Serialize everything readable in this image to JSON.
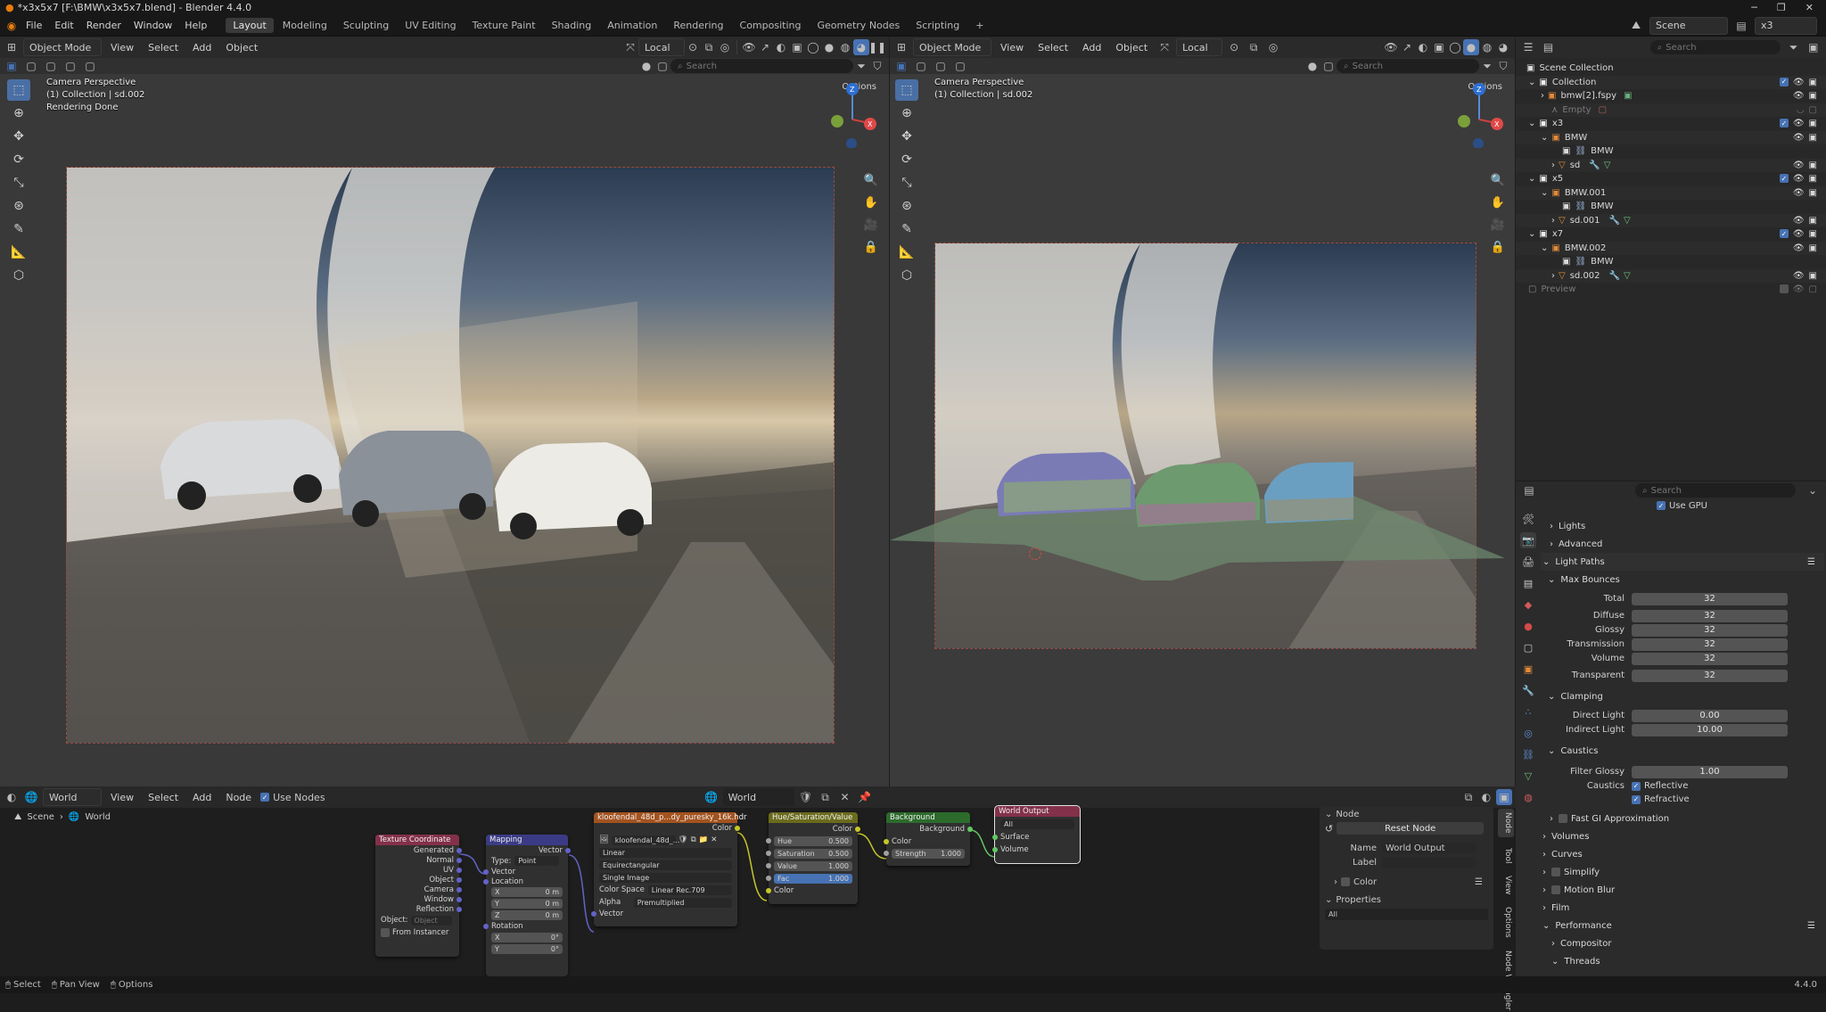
{
  "titlebar": {
    "title": "*x3x5x7 [F:\\BMW\\x3x5x7.blend] - Blender 4.4.0"
  },
  "menu": [
    "File",
    "Edit",
    "Render",
    "Window",
    "Help"
  ],
  "workspaces": [
    "Layout",
    "Modeling",
    "Sculpting",
    "UV Editing",
    "Texture Paint",
    "Shading",
    "Animation",
    "Rendering",
    "Compositing",
    "Geometry Nodes",
    "Scripting"
  ],
  "topright": {
    "scene": "Scene",
    "view_layer": "x3"
  },
  "vp_common": {
    "mode": "Object Mode",
    "menu": [
      "View",
      "Select",
      "Add",
      "Object"
    ],
    "orientation": "Local",
    "options": "Options",
    "search_placeholder": "Search"
  },
  "vp_left": {
    "info": [
      "Camera Perspective",
      "(1) Collection | sd.002",
      "Rendering Done"
    ]
  },
  "vp_right": {
    "info": [
      "Camera Perspective",
      "(1) Collection | sd.002"
    ]
  },
  "outliner": {
    "search_placeholder": "Search",
    "rows": [
      {
        "name": "Scene Collection"
      },
      {
        "name": "Collection"
      },
      {
        "name": "bmw[2].fspy"
      },
      {
        "name": "Empty"
      },
      {
        "name": "x3"
      },
      {
        "name": "BMW"
      },
      {
        "name": "BMW"
      },
      {
        "name": "sd"
      },
      {
        "name": "x5"
      },
      {
        "name": "BMW.001"
      },
      {
        "name": "BMW"
      },
      {
        "name": "sd.001"
      },
      {
        "name": "x7"
      },
      {
        "name": "BMW.002"
      },
      {
        "name": "BMW"
      },
      {
        "name": "sd.002"
      },
      {
        "name": "Preview"
      }
    ]
  },
  "properties": {
    "search_placeholder": "Search",
    "use_gpu": "Use GPU",
    "lights": "Lights",
    "advanced": "Advanced",
    "light_paths": "Light Paths",
    "max_bounces": "Max Bounces",
    "bounces": [
      {
        "label": "Total",
        "value": "32"
      },
      {
        "label": "Diffuse",
        "value": "32"
      },
      {
        "label": "Glossy",
        "value": "32"
      },
      {
        "label": "Transmission",
        "value": "32"
      },
      {
        "label": "Volume",
        "value": "32"
      },
      {
        "label": "Transparent",
        "value": "32"
      }
    ],
    "clamping": "Clamping",
    "clamp": [
      {
        "label": "Direct Light",
        "value": "0.00"
      },
      {
        "label": "Indirect Light",
        "value": "10.00"
      }
    ],
    "caustics": "Caustics",
    "filter_glossy_label": "Filter Glossy",
    "filter_glossy_value": "1.00",
    "caustics_label": "Caustics",
    "reflective": "Reflective",
    "refractive": "Refractive",
    "fast_gi": "Fast GI Approximation",
    "volumes": "Volumes",
    "curves": "Curves",
    "simplify": "Simplify",
    "motion_blur": "Motion Blur",
    "film": "Film",
    "performance": "Performance",
    "compositor": "Compositor",
    "threads": "Threads"
  },
  "node_editor": {
    "type": "World",
    "menu": [
      "View",
      "Select",
      "Add",
      "Node"
    ],
    "use_nodes": "Use Nodes",
    "world_name": "World",
    "breadcrumb": [
      "Scene",
      "World"
    ],
    "tex_coord": {
      "title": "Texture Coordinate",
      "outputs": [
        "Generated",
        "Normal",
        "UV",
        "Object",
        "Camera",
        "Window",
        "Reflection"
      ],
      "object_label": "Object:",
      "object_placeholder": "Object",
      "from_instancer": "From Instancer"
    },
    "mapping": {
      "title": "Mapping",
      "output": "Vector",
      "type_label": "Type:",
      "type_value": "Point",
      "vector": "Vector",
      "location": "Location",
      "loc": [
        {
          "axis": "X",
          "value": "0 m"
        },
        {
          "axis": "Y",
          "value": "0 m"
        },
        {
          "axis": "Z",
          "value": "0 m"
        }
      ],
      "rotation": "Rotation",
      "rot": [
        {
          "axis": "X",
          "value": "0°"
        },
        {
          "axis": "Y",
          "value": "0°"
        }
      ]
    },
    "env_tex": {
      "title": "kloofendal_48d_p...dy_puresky_16k.hdr",
      "color_out": "Color",
      "image": "kloofendal_48d_...",
      "interp": "Linear",
      "proj": "Equirectangular",
      "source": "Single Image",
      "cs_label": "Color Space",
      "cs_value": "Linear Rec.709",
      "alpha_label": "Alpha",
      "alpha_value": "Premultiplied",
      "vector": "Vector"
    },
    "hsv": {
      "title": "Hue/Saturation/Value",
      "color_out": "Color",
      "fields": [
        {
          "label": "Hue",
          "value": "0.500"
        },
        {
          "label": "Saturation",
          "value": "0.500"
        },
        {
          "label": "Value",
          "value": "1.000"
        },
        {
          "label": "Fac",
          "value": "1.000"
        }
      ],
      "color_in": "Color"
    },
    "background": {
      "title": "Background",
      "out": "Background",
      "color": "Color",
      "strength_label": "Strength",
      "strength_value": "1.000"
    },
    "world_output": {
      "title": "World Output",
      "target": "All",
      "surface": "Surface",
      "volume": "Volume"
    },
    "panel": {
      "node": "Node",
      "reset": "Reset Node",
      "name_label": "Name",
      "name_value": "World Output",
      "label_label": "Label",
      "color": "Color",
      "properties": "Properties",
      "all": "All"
    },
    "side_tabs": [
      "Node",
      "Tool",
      "View",
      "Options",
      "Node Wrangler"
    ]
  },
  "statusbar": {
    "select": "Select",
    "pan": "Pan View",
    "options": "Options",
    "version": "4.4.0"
  }
}
